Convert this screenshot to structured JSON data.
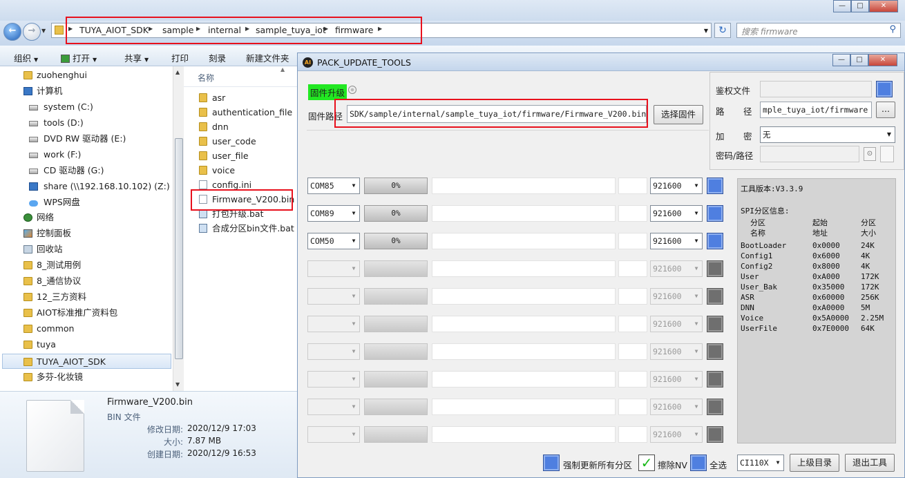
{
  "explorer": {
    "breadcrumb": [
      "TUYA_AIOT_SDK",
      "sample",
      "internal",
      "sample_tuya_iot",
      "firmware"
    ],
    "search_placeholder": "搜索 firmware",
    "toolbar": {
      "organize": "组织",
      "open": "打开",
      "share": "共享",
      "print": "打印",
      "burn": "刻录",
      "new_folder": "新建文件夹"
    },
    "nav_items": [
      {
        "label": "zuohenghui",
        "icon": "folder-icon",
        "indent": 1
      },
      {
        "label": "计算机",
        "icon": "computer-icon",
        "indent": 1
      },
      {
        "label": "system (C:)",
        "icon": "drive-icon",
        "indent": 2
      },
      {
        "label": "tools (D:)",
        "icon": "drive-icon",
        "indent": 2
      },
      {
        "label": "DVD RW 驱动器 (E:)",
        "icon": "dvd-drive-icon",
        "indent": 2
      },
      {
        "label": "work (F:)",
        "icon": "drive-icon",
        "indent": 2
      },
      {
        "label": "CD 驱动器 (G:)",
        "icon": "cd-drive-icon",
        "indent": 2
      },
      {
        "label": "share (\\\\192.168.10.102) (Z:)",
        "icon": "network-drive-icon",
        "indent": 2
      },
      {
        "label": "WPS网盘",
        "icon": "cloud-icon",
        "indent": 2
      },
      {
        "label": "网络",
        "icon": "network-icon",
        "indent": 1
      },
      {
        "label": "控制面板",
        "icon": "control-panel-icon",
        "indent": 1
      },
      {
        "label": "回收站",
        "icon": "recycle-bin-icon",
        "indent": 1
      },
      {
        "label": "8_测试用例",
        "icon": "folder-icon",
        "indent": 1
      },
      {
        "label": "8_通信协议",
        "icon": "folder-icon",
        "indent": 1
      },
      {
        "label": "12_三方资料",
        "icon": "folder-icon",
        "indent": 1
      },
      {
        "label": "AIOT标准推广资料包",
        "icon": "folder-icon",
        "indent": 1
      },
      {
        "label": "common",
        "icon": "folder-icon",
        "indent": 1
      },
      {
        "label": "tuya",
        "icon": "folder-icon",
        "indent": 1
      },
      {
        "label": "TUYA_AIOT_SDK",
        "icon": "folder-icon",
        "indent": 1,
        "selected": true
      },
      {
        "label": "多芬-化妆镜",
        "icon": "folder-icon",
        "indent": 1
      }
    ],
    "column_name": "名称",
    "files": [
      {
        "label": "asr",
        "icon": "folder-icon"
      },
      {
        "label": "authentication_file",
        "icon": "folder-icon"
      },
      {
        "label": "dnn",
        "icon": "folder-icon"
      },
      {
        "label": "user_code",
        "icon": "folder-icon"
      },
      {
        "label": "user_file",
        "icon": "folder-icon"
      },
      {
        "label": "voice",
        "icon": "folder-icon"
      },
      {
        "label": "config.ini",
        "icon": "ini-file-icon"
      },
      {
        "label": "Firmware_V200.bin",
        "icon": "file-icon"
      },
      {
        "label": "打包升级.bat",
        "icon": "bat-file-icon"
      },
      {
        "label": "合成分区bin文件.bat",
        "icon": "bat-file-icon"
      }
    ],
    "details": {
      "name": "Firmware_V200.bin",
      "type": "BIN 文件",
      "modified_label": "修改日期:",
      "modified": "2020/12/9 17:03",
      "size_label": "大小:",
      "size": "7.87 MB",
      "created_label": "创建日期:",
      "created": "2020/12/9 16:53"
    }
  },
  "tool": {
    "title": "PACK_UPDATE_TOOLS",
    "upgrade_label": "固件升级",
    "path_label": "固件路径",
    "path_value": "SDK/sample/internal/sample_tuya_iot/firmware/Firmware_V200.bin",
    "select_button": "选择固件",
    "auth_label": "鉴权文件",
    "path2_label_a": "路",
    "path2_label_b": "径",
    "path2_value": "mple_tuya_iot/firmware",
    "browse_button": "...",
    "encrypt_label_a": "加",
    "encrypt_label_b": "密",
    "encrypt_value": "无",
    "pwd_label": "密码/路径",
    "ports": [
      {
        "com": "COM85",
        "progress": "0%",
        "baud": "921600",
        "enabled": true
      },
      {
        "com": "COM89",
        "progress": "0%",
        "baud": "921600",
        "enabled": true
      },
      {
        "com": "COM50",
        "progress": "0%",
        "baud": "921600",
        "enabled": true
      },
      {
        "com": "",
        "progress": "",
        "baud": "921600",
        "enabled": false
      },
      {
        "com": "",
        "progress": "",
        "baud": "921600",
        "enabled": false
      },
      {
        "com": "",
        "progress": "",
        "baud": "921600",
        "enabled": false
      },
      {
        "com": "",
        "progress": "",
        "baud": "921600",
        "enabled": false
      },
      {
        "com": "",
        "progress": "",
        "baud": "921600",
        "enabled": false
      },
      {
        "com": "",
        "progress": "",
        "baud": "921600",
        "enabled": false
      },
      {
        "com": "",
        "progress": "",
        "baud": "921600",
        "enabled": false
      }
    ],
    "info": {
      "version": "工具版本:V3.3.9",
      "spi_title": "SPI分区信息:",
      "headers": [
        [
          "分区",
          "名称"
        ],
        [
          "起始",
          "地址"
        ],
        [
          "分区",
          "大小"
        ]
      ],
      "partitions": [
        [
          "BootLoader",
          "0x0000",
          "24K"
        ],
        [
          "Config1",
          "0x6000",
          "4K"
        ],
        [
          "Config2",
          "0x8000",
          "4K"
        ],
        [
          "User",
          "0xA000",
          "172K"
        ],
        [
          "User_Bak",
          "0x35000",
          "172K"
        ],
        [
          "ASR",
          "0x60000",
          "256K"
        ],
        [
          "DNN",
          "0xA0000",
          "5M"
        ],
        [
          "Voice",
          "0x5A0000",
          "2.25M"
        ],
        [
          "UserFile",
          "0x7E0000",
          "64K"
        ]
      ]
    },
    "bottom": {
      "force_label": "强制更新所有分区",
      "erase_label": "擦除NV",
      "select_all_label": "全选",
      "chip": "CI110X",
      "up_button": "上级目录",
      "exit_button": "退出工具"
    },
    "colors": {
      "highlight": "#22e822",
      "blue_square": "#4f7fe0",
      "gray_square": "#6f6f6f",
      "red_annotation": "#e8101c"
    }
  }
}
